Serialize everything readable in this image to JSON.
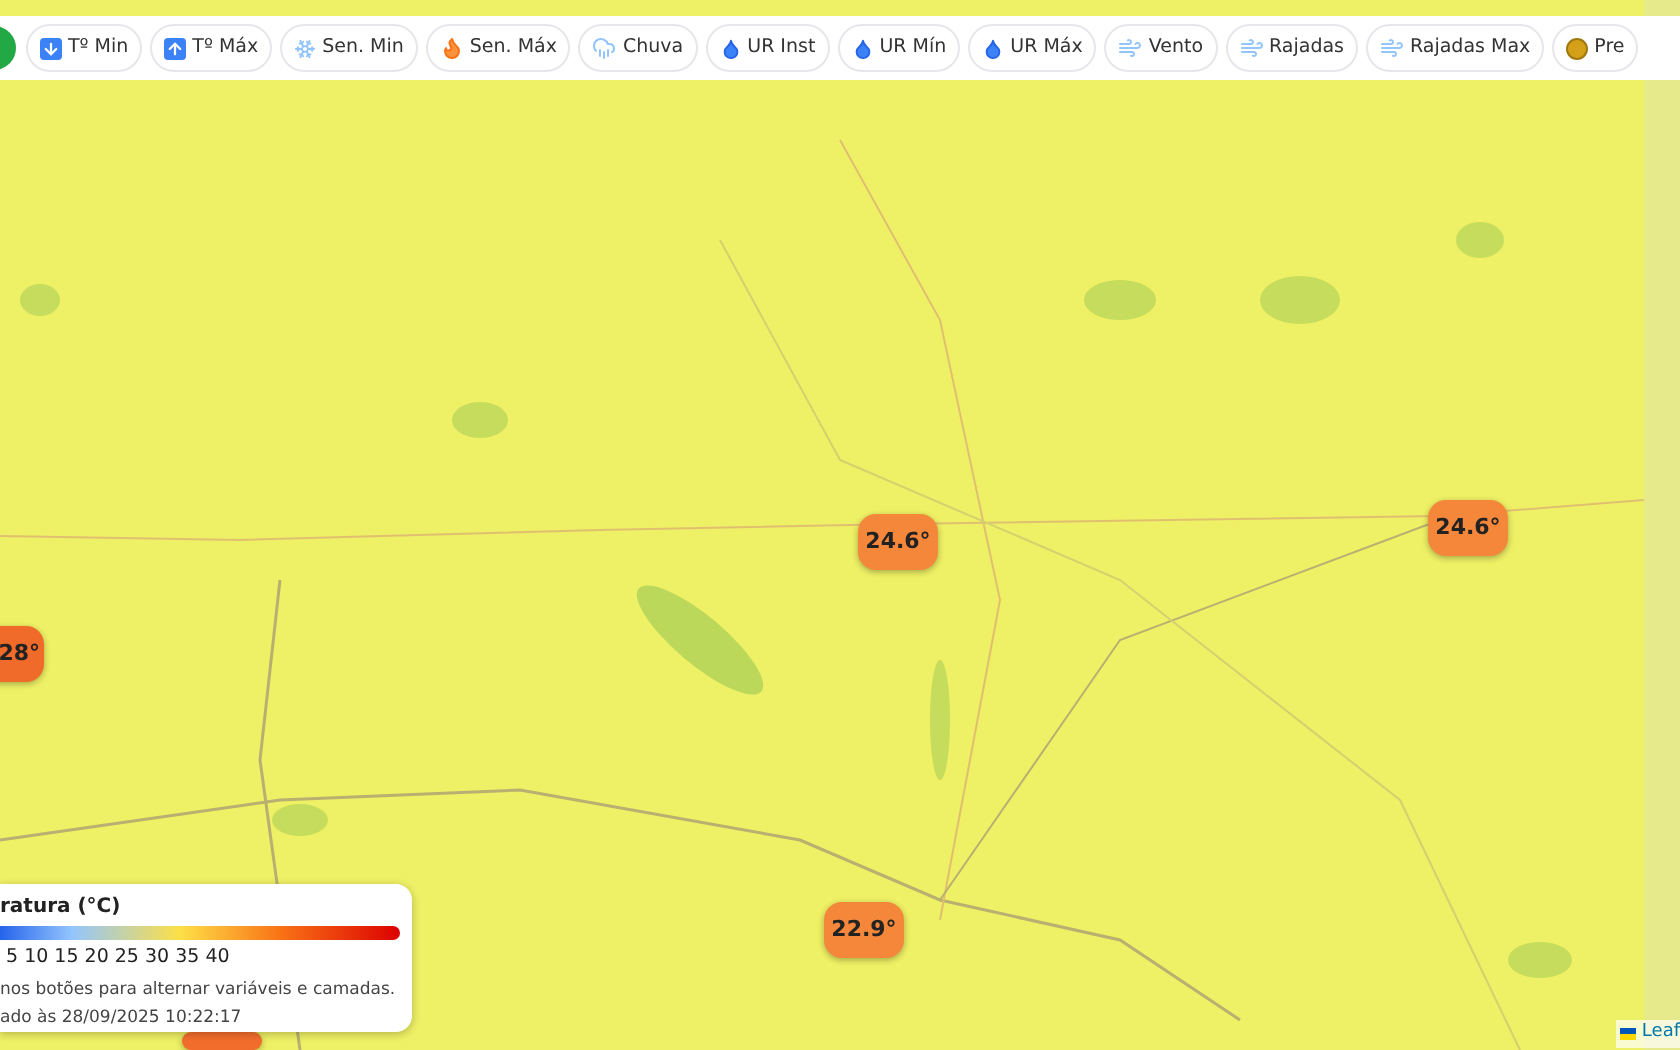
{
  "toolbar": {
    "buttons": [
      {
        "label": "Tº Min"
      },
      {
        "label": "Tº Máx"
      },
      {
        "label": "Sen. Min"
      },
      {
        "label": "Sen. Máx"
      },
      {
        "label": "Chuva"
      },
      {
        "label": "UR Inst"
      },
      {
        "label": "UR Mín"
      },
      {
        "label": "UR Máx"
      },
      {
        "label": "Vento"
      },
      {
        "label": "Rajadas"
      },
      {
        "label": "Rajadas Max"
      },
      {
        "label": "Pre"
      }
    ]
  },
  "markers": [
    {
      "label": "24.6°",
      "color": "#f5873a"
    },
    {
      "label": "24.6°",
      "color": "#f5873a"
    },
    {
      "label": "28°",
      "color": "#f06a2a"
    },
    {
      "label": "22.9°",
      "color": "#f5873a"
    },
    {
      "color": "#f26d2b"
    }
  ],
  "legend": {
    "title": "ratura (°C)",
    "scale": "5 10 15 20 25 30 35 40",
    "hint": "nos botões para alternar variáveis e camadas.",
    "updated": "ado às 28/09/2025 10:22:17"
  },
  "attribution": "Leaf"
}
